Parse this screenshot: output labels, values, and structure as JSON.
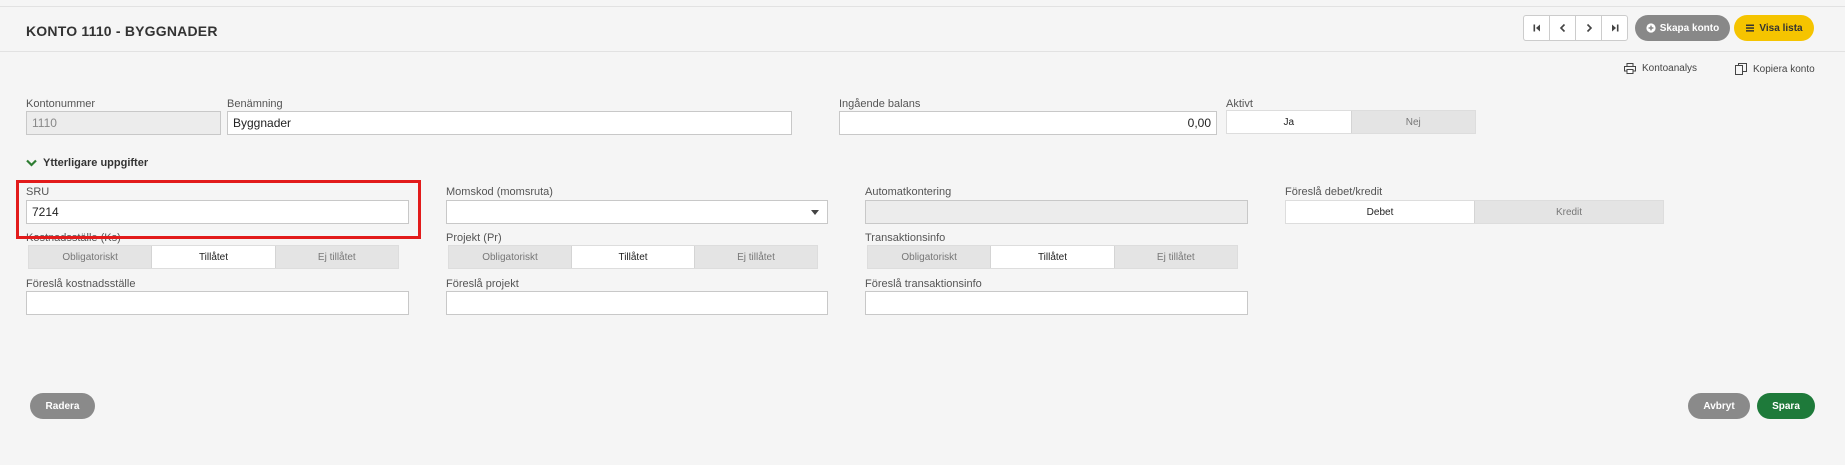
{
  "header": {
    "title": "KONTO 1110 - BYGGNADER",
    "nav": [
      "first",
      "prev",
      "next",
      "last"
    ],
    "create_label": "Skapa konto",
    "list_label": "Visa lista"
  },
  "actions": {
    "analysis_label": "Kontoanalys",
    "copy_label": "Kopiera konto"
  },
  "fields": {
    "kontonummer": {
      "label": "Kontonummer",
      "value": "1110"
    },
    "benamning": {
      "label": "Benämning",
      "value": "Byggnader"
    },
    "ingaende": {
      "label": "Ingående balans",
      "value": "0,00"
    },
    "aktivt": {
      "label": "Aktivt",
      "options": [
        "Ja",
        "Nej"
      ],
      "selected": "Ja"
    }
  },
  "details": {
    "toggle_label": "Ytterligare uppgifter",
    "sru": {
      "label": "SRU",
      "value": "7214"
    },
    "momskod": {
      "label": "Momskod (momsruta)",
      "value": ""
    },
    "automatkontering": {
      "label": "Automatkontering",
      "value": ""
    },
    "debet_kredit": {
      "label": "Föreslå debet/kredit",
      "options": [
        "Debet",
        "Kredit"
      ],
      "selected": "Debet"
    },
    "kostnadsstalle": {
      "label": "Kostnadsställe (Ks)",
      "options": [
        "Obligatoriskt",
        "Tillåtet",
        "Ej tillåtet"
      ],
      "selected": "Tillåtet"
    },
    "projekt": {
      "label": "Projekt (Pr)",
      "options": [
        "Obligatoriskt",
        "Tillåtet",
        "Ej tillåtet"
      ],
      "selected": "Tillåtet"
    },
    "transaktionsinfo": {
      "label": "Transaktionsinfo",
      "options": [
        "Obligatoriskt",
        "Tillåtet",
        "Ej tillåtet"
      ],
      "selected": "Tillåtet"
    },
    "foresla_ks": {
      "label": "Föreslå kostnadsställe",
      "value": ""
    },
    "foresla_pr": {
      "label": "Föreslå projekt",
      "value": ""
    },
    "foresla_ti": {
      "label": "Föreslå transaktionsinfo",
      "value": ""
    }
  },
  "footer": {
    "delete_label": "Radera",
    "cancel_label": "Avbryt",
    "save_label": "Spara"
  },
  "colors": {
    "highlight": "#e21b1b",
    "save": "#1e7a3a",
    "list_button": "#f5c400",
    "grey_button": "#8a8a8a"
  }
}
